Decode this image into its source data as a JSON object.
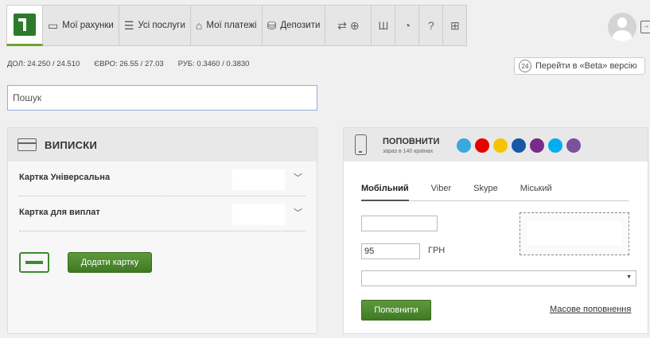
{
  "nav": {
    "tabs": [
      {
        "label": "Мої рахунки",
        "icon": "card-icon"
      },
      {
        "label": "Усі послуги",
        "icon": "list-icon"
      },
      {
        "label": "Мої платежі",
        "icon": "house-icon"
      },
      {
        "label": "Депозити",
        "icon": "coins-icon"
      }
    ],
    "icons": [
      "transfer-icon",
      "trident-icon",
      "timer-icon",
      "help-icon",
      "cart-icon"
    ]
  },
  "rates": [
    {
      "currency": "ДОЛ:",
      "value": "24.250 / 24.510"
    },
    {
      "currency": "ЄВРО:",
      "value": "26.55 / 27.03"
    },
    {
      "currency": "РУБ:",
      "value": "0.3460 / 0.3830"
    }
  ],
  "beta": {
    "count": "24",
    "label": "Перейти в «Beta» версію"
  },
  "search": {
    "placeholder": "Пошук"
  },
  "statements": {
    "title": "ВИПИСКИ",
    "cards": [
      {
        "name": "Картка Універсальна"
      },
      {
        "name": "Картка для виплат"
      }
    ],
    "add_card_label": "Додати картку"
  },
  "topup": {
    "title": "ПОПОВНИТИ",
    "subtitle": "зараз в 140 країнах",
    "operators": [
      {
        "name": "kyivstar",
        "color": "#39a8e0"
      },
      {
        "name": "vodafone",
        "color": "#e60000"
      },
      {
        "name": "lifecell",
        "color": "#f5c400"
      },
      {
        "name": "intertelecom",
        "color": "#1a56a8"
      },
      {
        "name": "peoplenet",
        "color": "#7a2a8a"
      },
      {
        "name": "skype",
        "color": "#00aff0"
      },
      {
        "name": "viber",
        "color": "#7b519d"
      }
    ],
    "tabs": [
      "Мобільний",
      "Viber",
      "Skype",
      "Міський"
    ],
    "amount": "95",
    "currency": "ГРН",
    "submit_label": "Поповнити",
    "mass_link": "Масове поповнення"
  },
  "colors": {
    "accent_green": "#3f7a24",
    "search_border": "#8ab0dd"
  }
}
